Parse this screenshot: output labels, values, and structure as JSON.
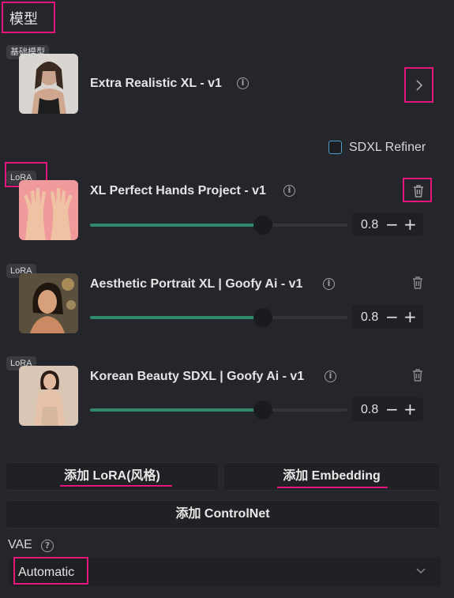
{
  "section": {
    "title": "模型"
  },
  "base_model": {
    "tag": "基础模型",
    "title": "Extra Realistic XL - v1"
  },
  "refiner": {
    "label": "SDXL Refiner",
    "checked": false
  },
  "loras": [
    {
      "tag": "LoRA",
      "title": "XL Perfect Hands Project - v1",
      "value": "0.8",
      "weight_fraction": 0.8
    },
    {
      "tag": "LoRA",
      "title": "Aesthetic Portrait XL | Goofy Ai - v1",
      "value": "0.8",
      "weight_fraction": 0.8
    },
    {
      "tag": "LoRA",
      "title": "Korean Beauty SDXL | Goofy Ai - v1",
      "value": "0.8",
      "weight_fraction": 0.8
    }
  ],
  "buttons": {
    "add_lora": "添加 LoRA(风格)",
    "add_embedding": "添加 Embedding",
    "add_controlnet": "添加 ControlNet"
  },
  "vae": {
    "label": "VAE",
    "value": "Automatic"
  },
  "colors": {
    "accent": "#2f8a6c",
    "highlight": "#e8157a",
    "background": "#25262b"
  }
}
